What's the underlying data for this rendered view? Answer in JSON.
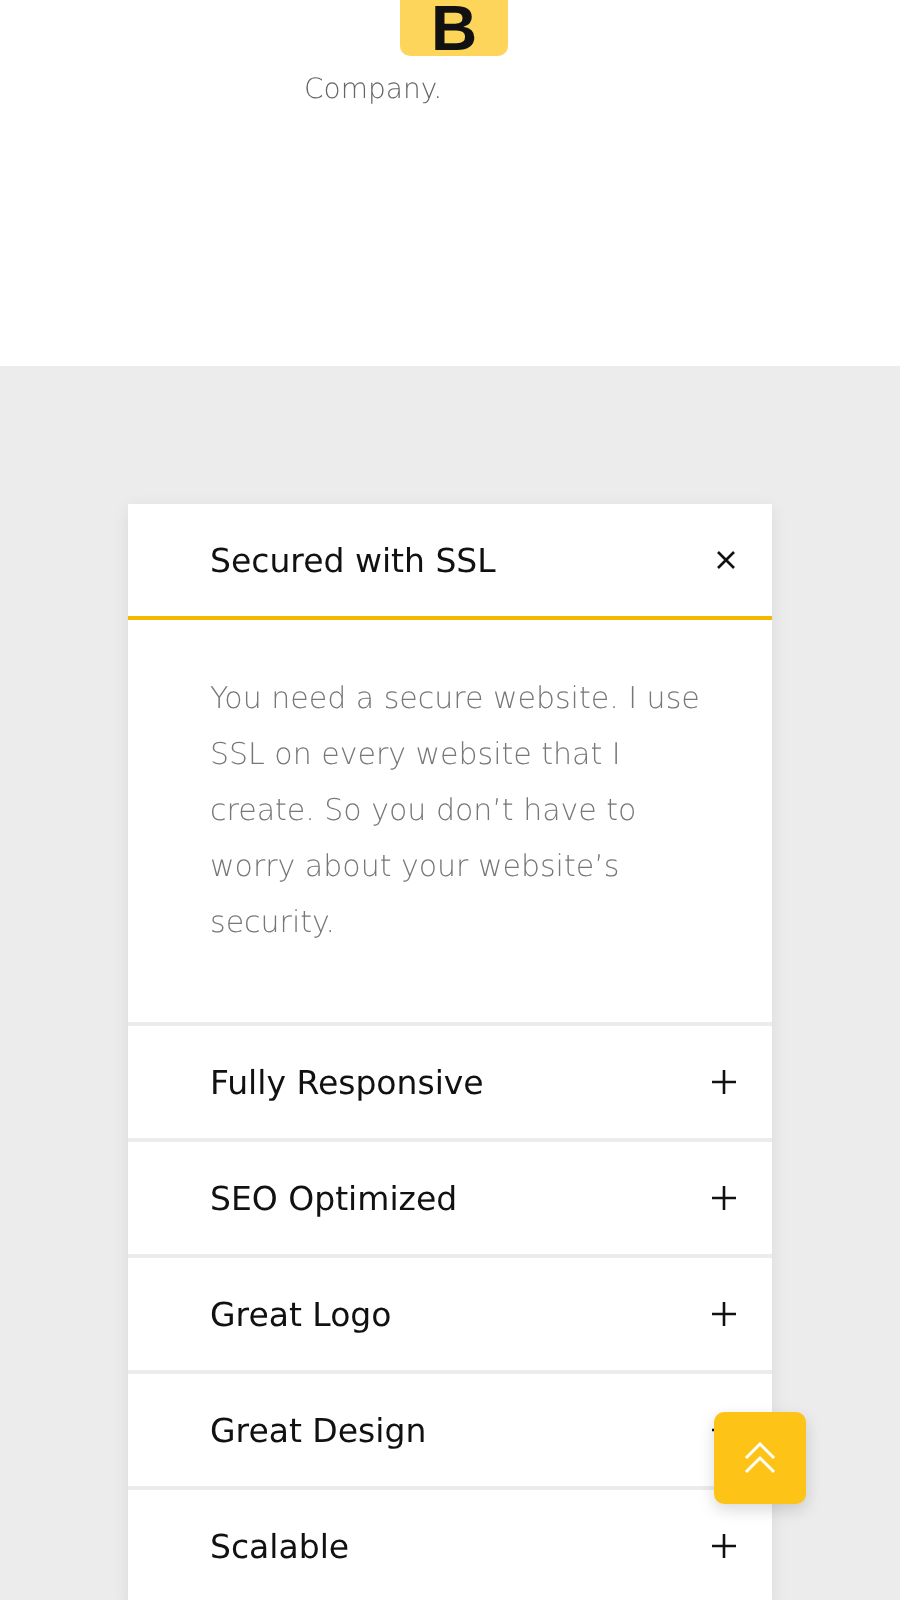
{
  "header": {
    "logo_letter": "B",
    "tagline": "Company."
  },
  "accordion": [
    {
      "title": "Secured with SSL",
      "expanded": true,
      "body": "You need a secure website. I use SSL on every website that I create. So you don’t have to worry about your website’s security."
    },
    {
      "title": "Fully Responsive",
      "expanded": false
    },
    {
      "title": "SEO Optimized",
      "expanded": false
    },
    {
      "title": "Great Logo",
      "expanded": false
    },
    {
      "title": "Great Design",
      "expanded": false
    },
    {
      "title": "Scalable",
      "expanded": false
    }
  ]
}
